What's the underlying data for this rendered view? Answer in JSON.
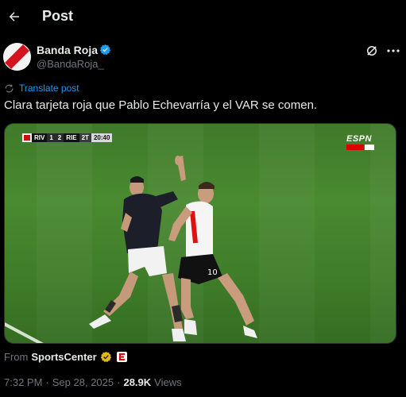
{
  "header": {
    "title": "Post",
    "back_icon": "arrow-left-icon"
  },
  "author": {
    "name": "Banda Roja",
    "handle": "@BandaRoja_",
    "verified_color": "#1d9bf0"
  },
  "translate": {
    "label": "Translate post"
  },
  "tweet": {
    "text": "Clara tarjeta roja que Pablo Echevarría y el VAR se comen."
  },
  "media": {
    "scorebug": {
      "home": "RIV",
      "home_score": "1",
      "away_score": "2",
      "away": "RIE",
      "period": "2T",
      "clock": "20:40"
    },
    "broadcaster": "ESPN",
    "player_numbers": [
      "10"
    ]
  },
  "source": {
    "prefix": "From",
    "name": "SportsCenter"
  },
  "meta": {
    "time": "7:32 PM",
    "date": "Sep 28, 2025",
    "views_count": "28.9K",
    "views_label": "Views"
  },
  "colors": {
    "background": "#000000",
    "text": "#e7e9ea",
    "muted": "#71767b",
    "accent": "#1d9bf0",
    "gold": "#e2b719"
  }
}
